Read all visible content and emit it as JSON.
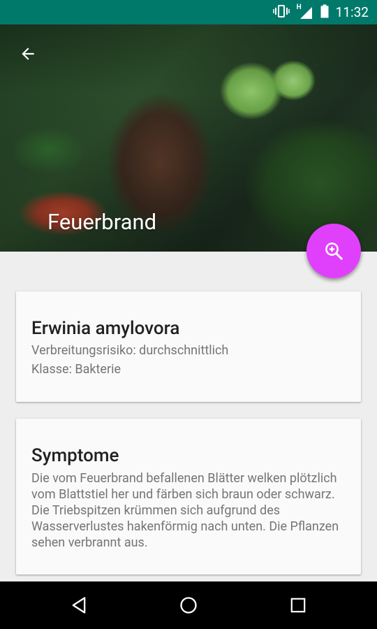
{
  "status_bar": {
    "time": "11:32",
    "network_label": "H",
    "icons": [
      "vibrate-icon",
      "signal-icon",
      "battery-icon"
    ]
  },
  "hero": {
    "title": "Feuerbrand"
  },
  "fab": {
    "icon": "zoom-in-icon",
    "color": "#e040fb"
  },
  "card1": {
    "title": "Erwinia amylovora",
    "risk": "Verbreitungsrisiko: durchschnittlich",
    "class": "Klasse: Bakterie"
  },
  "card2": {
    "title": "Symptome",
    "body": "Die vom Feuerbrand befallenen Blätter welken plötzlich vom Blattstiel her und färben sich braun oder schwarz. Die Triebspitzen krümmen sich aufgrund des Wasserverlustes hakenförmig nach unten. Die Pflanzen sehen verbrannt aus."
  },
  "nav": {
    "icons": [
      "back-triangle-icon",
      "home-circle-icon",
      "recents-square-icon"
    ]
  },
  "colors": {
    "status_bar": "#00796b",
    "fab": "#e040fb",
    "background": "#eeeeee",
    "card": "#fafafa"
  }
}
